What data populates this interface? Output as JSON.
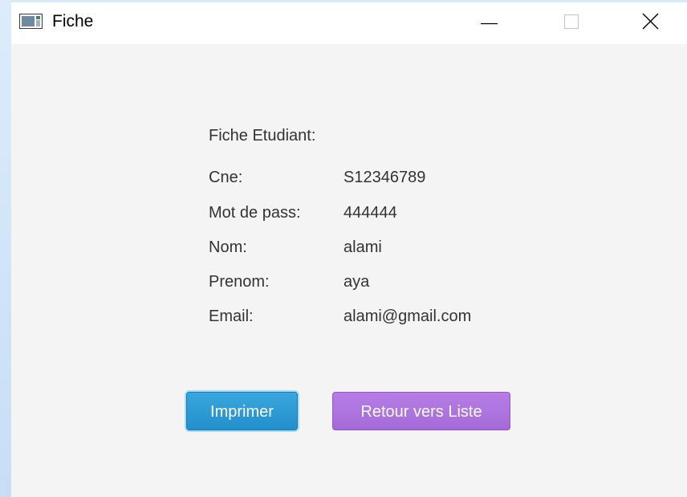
{
  "window": {
    "title": "Fiche"
  },
  "section": {
    "title": "Fiche Etudiant:"
  },
  "fields": [
    {
      "label": "Cne:",
      "value": "S12346789"
    },
    {
      "label": "Mot de pass:",
      "value": "444444"
    },
    {
      "label": "Nom:",
      "value": "alami"
    },
    {
      "label": "Prenom:",
      "value": "aya"
    },
    {
      "label": "Email:",
      "value": "alami@gmail.com"
    }
  ],
  "buttons": {
    "print": "Imprimer",
    "back": "Retour vers Liste"
  },
  "colors": {
    "print_button": "#2a9ad4",
    "back_button": "#ad73df",
    "window_background": "#f4f4f4"
  }
}
